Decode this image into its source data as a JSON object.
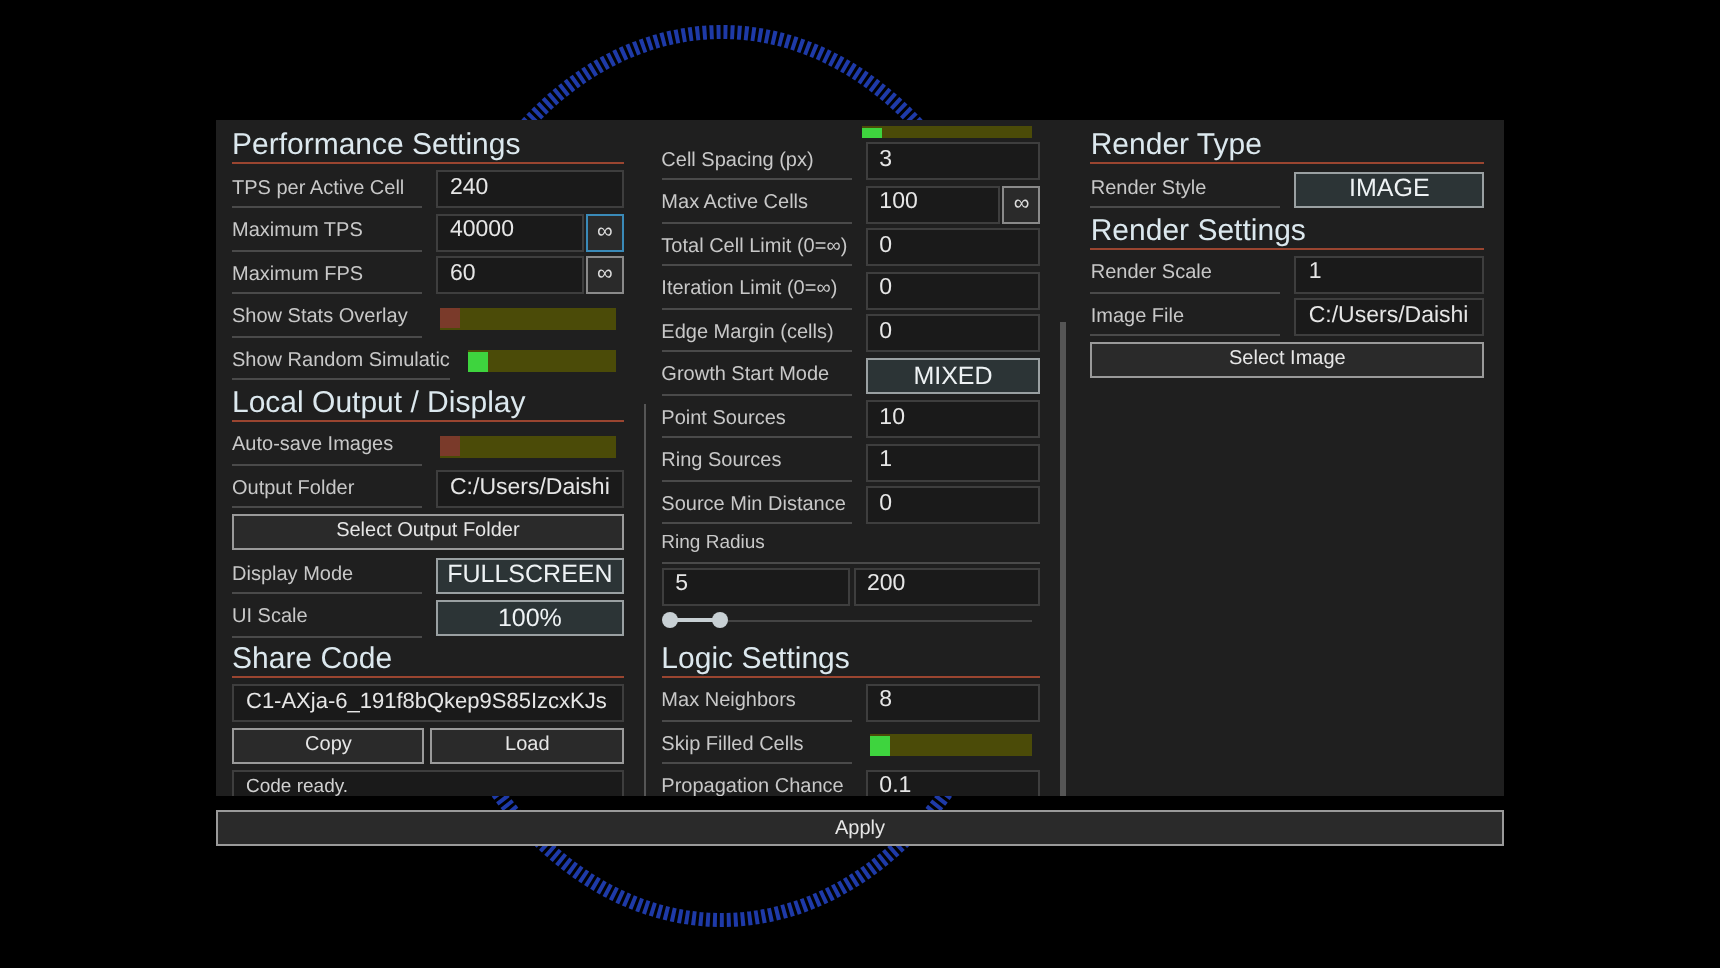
{
  "columns": [
    {
      "scrollbar": true,
      "items": [
        {
          "kind": "heading",
          "text": "Performance Settings"
        },
        {
          "kind": "field",
          "label": "TPS per Active Cell",
          "value": "240"
        },
        {
          "kind": "field_inf",
          "label": "Maximum TPS",
          "value": "40000",
          "button": "∞",
          "selected": true
        },
        {
          "kind": "field_inf",
          "label": "Maximum FPS",
          "value": "60",
          "button": "∞",
          "selected": false
        },
        {
          "kind": "toggle",
          "label": "Show Stats Overlay",
          "on": false
        },
        {
          "kind": "toggle",
          "label": "Show Random Simulatic",
          "on": true
        },
        {
          "kind": "heading",
          "text": "Local Output / Display"
        },
        {
          "kind": "toggle",
          "label": "Auto-save Images",
          "on": false
        },
        {
          "kind": "field",
          "label": "Output Folder",
          "value": "C:/Users/Daishi"
        },
        {
          "kind": "button",
          "text": "Select Output Folder"
        },
        {
          "kind": "choice",
          "label": "Display Mode",
          "value": "FULLSCREEN"
        },
        {
          "kind": "choice",
          "label": "UI Scale",
          "value": "100%"
        },
        {
          "kind": "heading",
          "text": "Share Code"
        },
        {
          "kind": "code",
          "value": "C1-AXja-6_191f8bQkep9S85IzcxKJs"
        },
        {
          "kind": "pair",
          "buttons": [
            "Copy",
            "Load"
          ]
        },
        {
          "kind": "status",
          "text": "Code ready."
        }
      ]
    },
    {
      "scrollbar": true,
      "items": [
        {
          "kind": "toggle_cut",
          "on": true
        },
        {
          "kind": "field",
          "label": "Cell Spacing (px)",
          "value": "3"
        },
        {
          "kind": "field_inf",
          "label": "Max Active Cells",
          "value": "100",
          "button": "∞",
          "selected": false
        },
        {
          "kind": "field",
          "label": "Total Cell Limit (0=∞)",
          "value": "0"
        },
        {
          "kind": "field",
          "label": "Iteration Limit (0=∞)",
          "value": "0"
        },
        {
          "kind": "field",
          "label": "Edge Margin (cells)",
          "value": "0"
        },
        {
          "kind": "choice",
          "label": "Growth Start Mode",
          "value": "MIXED"
        },
        {
          "kind": "field",
          "label": "Point Sources",
          "value": "10"
        },
        {
          "kind": "field",
          "label": "Ring Sources",
          "value": "1"
        },
        {
          "kind": "field",
          "label": "Source Min Distance",
          "value": "0"
        },
        {
          "kind": "range",
          "label": "Ring Radius",
          "low": "5",
          "high": "200",
          "thumbs": [
            {
              "level": 0
            },
            {
              "level": 0.14
            }
          ]
        },
        {
          "kind": "heading",
          "text": "Logic Settings"
        },
        {
          "kind": "field",
          "label": "Max Neighbors",
          "value": "8"
        },
        {
          "kind": "toggle",
          "label": "Skip Filled Cells",
          "on": true
        },
        {
          "kind": "field",
          "label": "Propagation Chance",
          "value": "0.1"
        }
      ]
    },
    {
      "items": [
        {
          "kind": "heading",
          "text": "Render Type"
        },
        {
          "kind": "choice",
          "label": "Render Style",
          "value": "IMAGE"
        },
        {
          "kind": "heading",
          "text": "Render Settings"
        },
        {
          "kind": "field",
          "label": "Render Scale",
          "value": "1"
        },
        {
          "kind": "field",
          "label": "Image File",
          "value": "C:/Users/Daishi"
        },
        {
          "kind": "button",
          "text": "Select Image"
        }
      ]
    }
  ],
  "apply_button": "Apply"
}
